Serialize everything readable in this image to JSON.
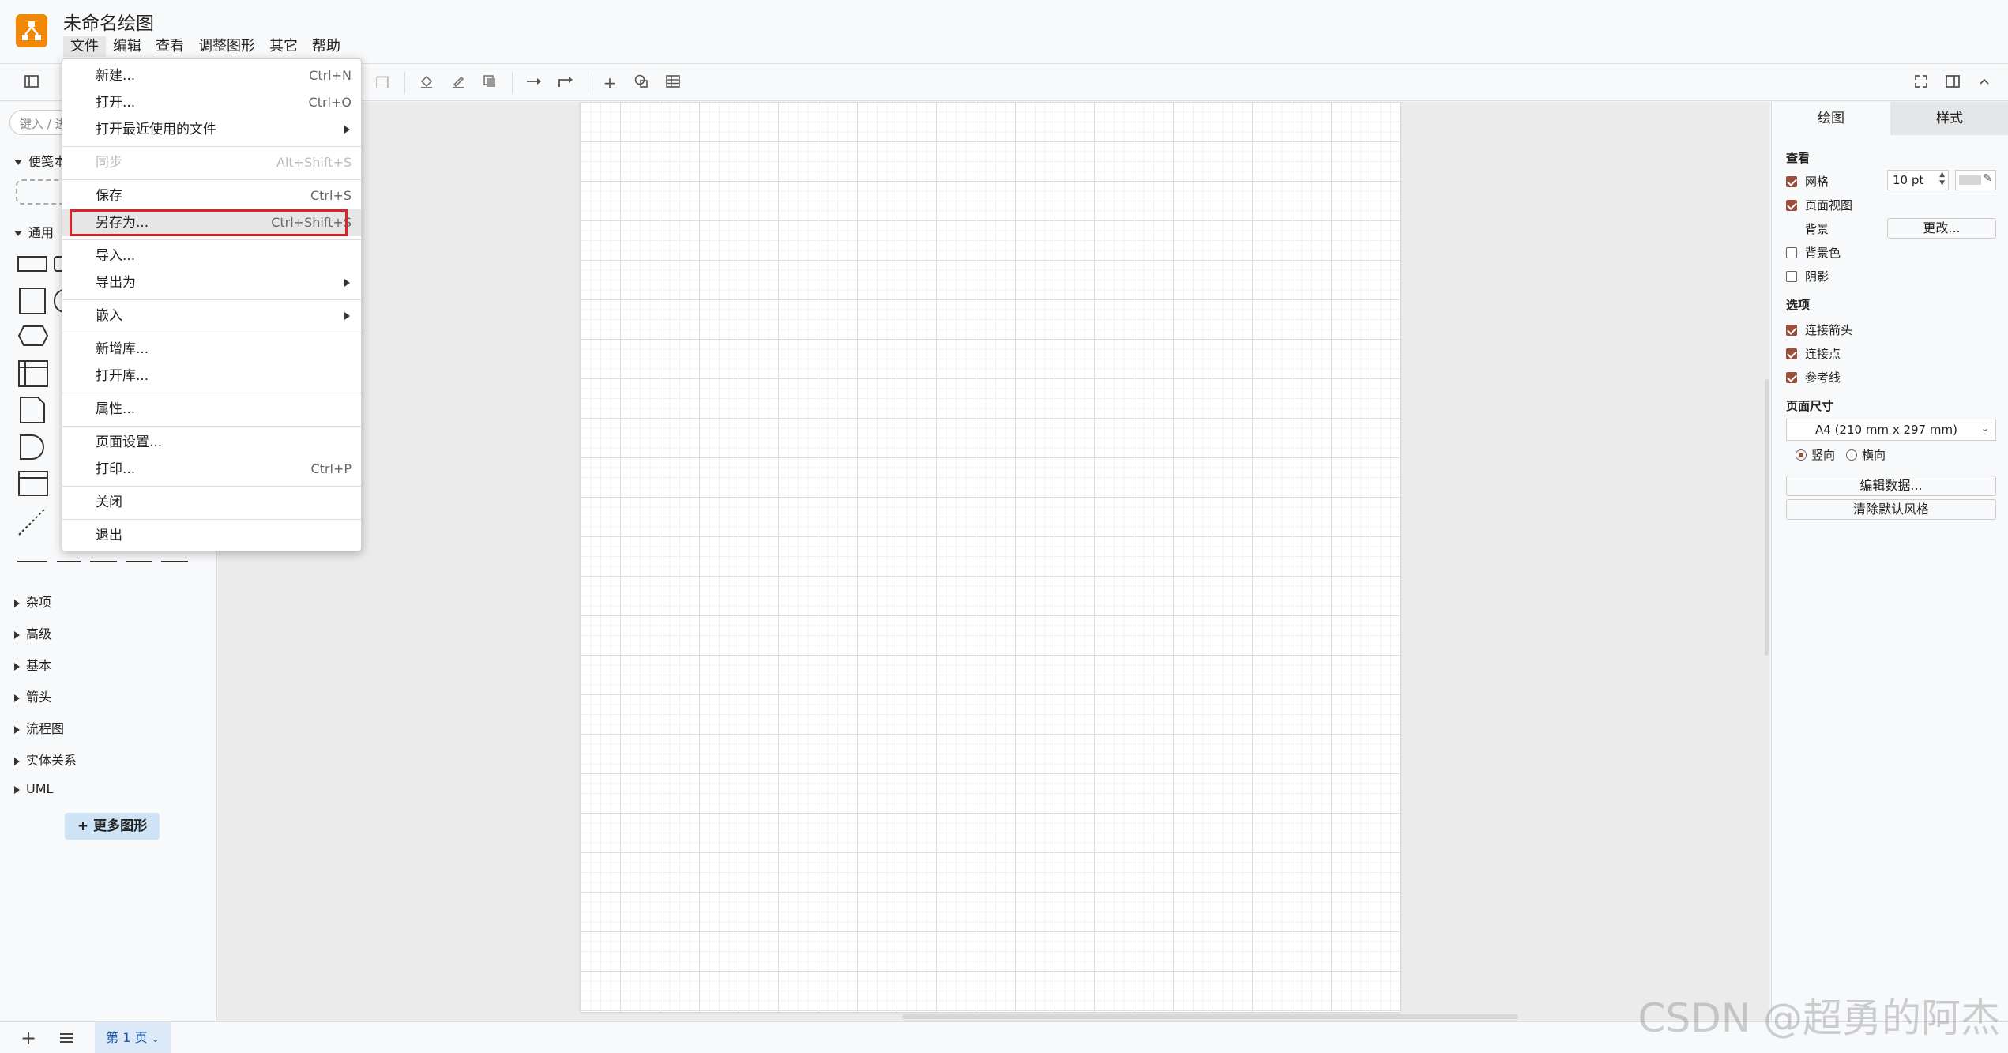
{
  "app": {
    "title": "未命名绘图",
    "logo_color": "#f08705"
  },
  "menubar": [
    {
      "label": "文件",
      "active": true
    },
    {
      "label": "编辑"
    },
    {
      "label": "查看"
    },
    {
      "label": "调整图形"
    },
    {
      "label": "其它"
    },
    {
      "label": "帮助"
    }
  ],
  "file_menu": {
    "items": [
      {
        "label": "新建...",
        "shortcut": "Ctrl+N"
      },
      {
        "label": "打开...",
        "shortcut": "Ctrl+O"
      },
      {
        "label": "打开最近使用的文件",
        "submenu": true
      },
      {
        "label": "同步",
        "shortcut": "Alt+Shift+S",
        "disabled": true
      },
      {
        "label": "保存",
        "shortcut": "Ctrl+S"
      },
      {
        "label": "另存为...",
        "shortcut": "Ctrl+Shift+S",
        "highlighted": true
      },
      {
        "label": "导入..."
      },
      {
        "label": "导出为",
        "submenu": true
      },
      {
        "label": "嵌入",
        "submenu": true
      },
      {
        "label": "新增库..."
      },
      {
        "label": "打开库..."
      },
      {
        "label": "属性..."
      },
      {
        "label": "页面设置..."
      },
      {
        "label": "打印...",
        "shortcut": "Ctrl+P"
      },
      {
        "label": "关闭"
      },
      {
        "label": "退出"
      }
    ],
    "highlight_color": "#e0202a"
  },
  "left_panel": {
    "search_placeholder": "键入 / 进行搜索",
    "scratchpad": "便笺本",
    "general": "通用",
    "categories": [
      "杂项",
      "高级",
      "基本",
      "箭头",
      "流程图",
      "实体关系",
      "UML"
    ],
    "more_shapes": "+ 更多图形"
  },
  "right_panel": {
    "tabs": [
      "绘图",
      "样式"
    ],
    "view_title": "查看",
    "grid": {
      "label": "网格",
      "checked": true,
      "size": "10 pt"
    },
    "page_view": {
      "label": "页面视图",
      "checked": true
    },
    "background": {
      "label": "背景",
      "button": "更改..."
    },
    "background_color": {
      "label": "背景色",
      "checked": false
    },
    "shadow": {
      "label": "阴影",
      "checked": false
    },
    "options_title": "选项",
    "connection_arrows": {
      "label": "连接箭头",
      "checked": true
    },
    "connection_points": {
      "label": "连接点",
      "checked": true
    },
    "guides": {
      "label": "参考线",
      "checked": true
    },
    "page_size_title": "页面尺寸",
    "page_size_value": "A4 (210 mm x 297 mm)",
    "portrait": "竖向",
    "landscape": "横向",
    "edit_data": "编辑数据...",
    "clear_default_style": "清除默认风格"
  },
  "bottom": {
    "page_tab": "第 1 页"
  },
  "watermark": "CSDN @超勇的阿杰"
}
